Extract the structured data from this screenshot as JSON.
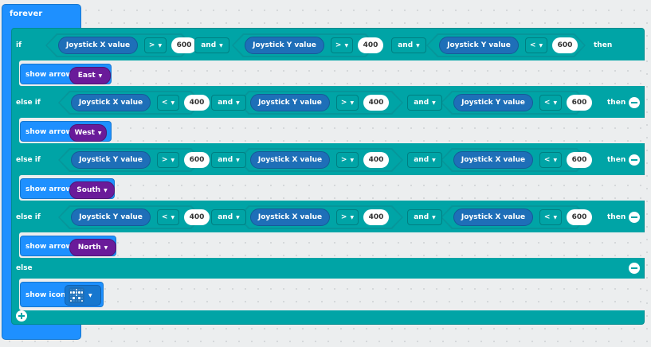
{
  "forever": {
    "label": "forever"
  },
  "conditions": [
    {
      "keyword": "if",
      "then": "then",
      "removable": false,
      "clauses": [
        {
          "sensor": "Joystick X value",
          "op": ">",
          "value": "600"
        },
        {
          "sensor": "Joystick Y value",
          "op": ">",
          "value": "400"
        },
        {
          "sensor": "Joystick Y value",
          "op": "<",
          "value": "600"
        }
      ],
      "joins": [
        "and",
        "and"
      ],
      "action": {
        "label": "show arrow",
        "direction": "East"
      }
    },
    {
      "keyword": "else if",
      "then": "then",
      "removable": true,
      "clauses": [
        {
          "sensor": "Joystick X value",
          "op": "<",
          "value": "400"
        },
        {
          "sensor": "Joystick Y value",
          "op": ">",
          "value": "400"
        },
        {
          "sensor": "Joystick Y value",
          "op": "<",
          "value": "600"
        }
      ],
      "joins": [
        "and",
        "and"
      ],
      "action": {
        "label": "show arrow",
        "direction": "West"
      }
    },
    {
      "keyword": "else if",
      "then": "then",
      "removable": true,
      "clauses": [
        {
          "sensor": "Joystick Y value",
          "op": ">",
          "value": "600"
        },
        {
          "sensor": "Joystick X value",
          "op": ">",
          "value": "400"
        },
        {
          "sensor": "Joystick X value",
          "op": "<",
          "value": "600"
        }
      ],
      "joins": [
        "and",
        "and"
      ],
      "action": {
        "label": "show arrow",
        "direction": "South"
      }
    },
    {
      "keyword": "else if",
      "then": "then",
      "removable": true,
      "clauses": [
        {
          "sensor": "Joystick Y value",
          "op": "<",
          "value": "400"
        },
        {
          "sensor": "Joystick X value",
          "op": ">",
          "value": "400"
        },
        {
          "sensor": "Joystick X value",
          "op": "<",
          "value": "600"
        }
      ],
      "joins": [
        "and",
        "and"
      ],
      "action": {
        "label": "show arrow",
        "direction": "North"
      }
    }
  ],
  "else_branch": {
    "keyword": "else",
    "action": {
      "label": "show icon",
      "icon": "person-icon"
    }
  },
  "colors": {
    "forever": "#1e90ff",
    "logic": "#00a4a6",
    "sensor": "#1e6fb8",
    "direction": "#6a1b9a",
    "workspace": "#eceeef"
  }
}
